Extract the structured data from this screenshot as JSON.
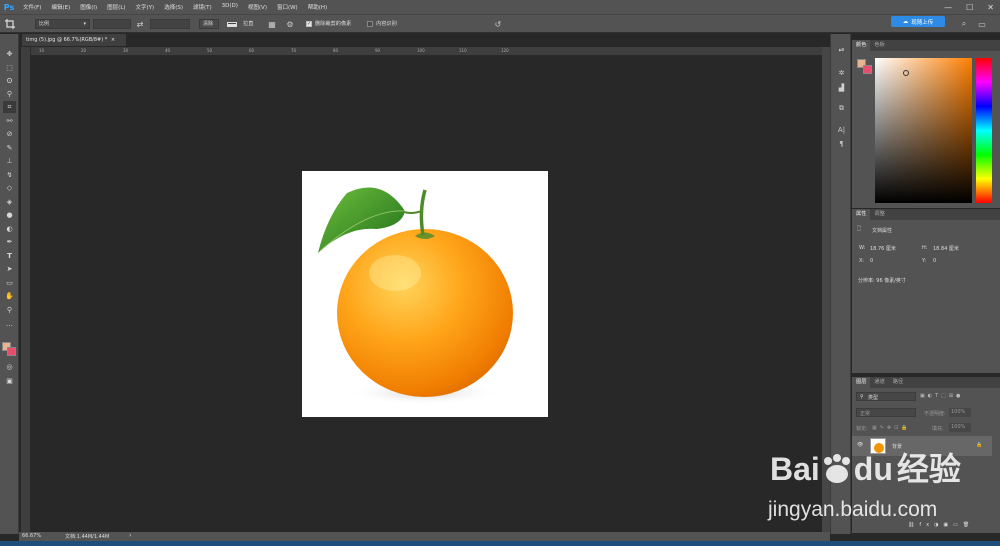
{
  "app": {
    "logo": "Ps"
  },
  "menus": [
    "文件(F)",
    "编辑(E)",
    "图像(I)",
    "图层(L)",
    "文字(Y)",
    "选择(S)",
    "滤镜(T)",
    "3D(D)",
    "视图(V)",
    "窗口(W)",
    "帮助(H)"
  ],
  "window_controls": [
    "—",
    "☐",
    "✕"
  ],
  "options": {
    "ratio_select": "比例",
    "clear_button": "清除",
    "straighten_label": "拉直",
    "delete_cropped": "删除裁剪的像素",
    "delete_cropped_checked": true,
    "content_aware": "内容识别",
    "content_aware_checked": false
  },
  "share_button": "现随上传",
  "document": {
    "tab_title": "timg (5).jpg @ 66.7%(RGB/8#) *",
    "tab_close": "×",
    "ruler_marks": [
      "10",
      "20",
      "30",
      "40",
      "50",
      "60",
      "70",
      "80",
      "90",
      "100",
      "110",
      "120"
    ]
  },
  "status": {
    "zoom": "66.67%",
    "doc_info": "文档:1.44M/1.44M"
  },
  "color_panel": {
    "tabs": [
      "颜色",
      "色板"
    ],
    "foreground": "#e8b38f",
    "background": "#e84d6e"
  },
  "properties_panel": {
    "tabs": [
      "属性",
      "调整"
    ],
    "section": "文档属性",
    "w_label": "W:",
    "w_value": "18.76 厘米",
    "h_label": "H:",
    "h_value": "18.84 厘米",
    "x_label": "X:",
    "x_value": "0",
    "y_label": "Y:",
    "y_value": "0",
    "resolution": "分辨率: 96 像素/英寸"
  },
  "layers_panel": {
    "tabs": [
      "图层",
      "通道",
      "路径"
    ],
    "filter": "类型",
    "blend_mode": "正常",
    "opacity_label": "不透明度:",
    "opacity": "100%",
    "lock_label": "锁定:",
    "fill_label": "填充:",
    "fill": "100%",
    "layer_name": "背景"
  },
  "watermark": {
    "brand": "Bai",
    "brand2": "du",
    "cn": "经验",
    "url": "jingyan.baidu.com"
  }
}
